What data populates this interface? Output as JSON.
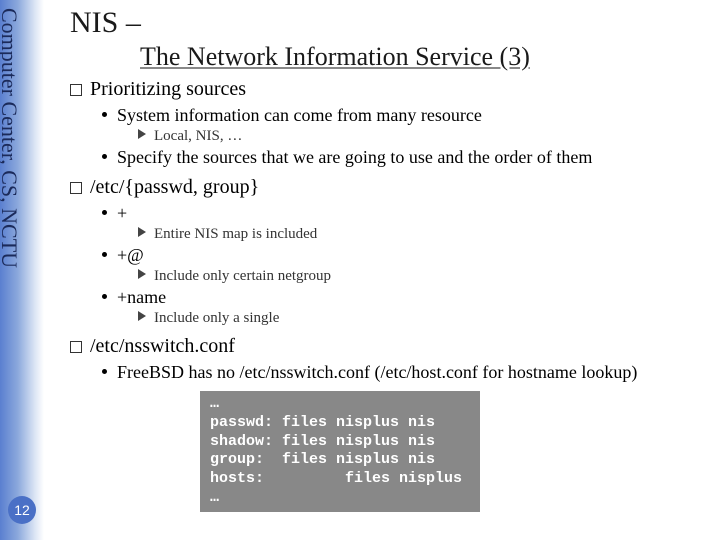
{
  "sidebar": {
    "text": "Computer Center, CS, NCTU"
  },
  "pageNumber": "12",
  "title": {
    "line1": "NIS –",
    "line2": "The Network Information Service (3)"
  },
  "sections": [
    {
      "head": "Prioritizing sources",
      "bullets": [
        {
          "text": "System information can come from many resource",
          "tris": [
            {
              "t": "Local, NIS, …"
            }
          ]
        },
        {
          "text": "Specify the sources that we are going to use and the order of them"
        }
      ]
    },
    {
      "head": "/etc/{passwd, group}",
      "bullets": [
        {
          "text": "+",
          "tris": [
            {
              "t": "Entire NIS map is included"
            }
          ]
        },
        {
          "text": "+@",
          "tris": [
            {
              "t": "Include only certain netgroup"
            }
          ]
        },
        {
          "text": "+name",
          "tris": [
            {
              "t": "Include only a single"
            }
          ]
        }
      ]
    },
    {
      "head": "/etc/nsswitch.conf",
      "bullets": [
        {
          "text": "FreeBSD has no /etc/nsswitch.conf  (/etc/host.conf for hostname lookup)"
        }
      ]
    }
  ],
  "code": "…\npasswd: files nisplus nis\nshadow: files nisplus nis\ngroup:  files nisplus nis\nhosts:         files nisplus\n…"
}
